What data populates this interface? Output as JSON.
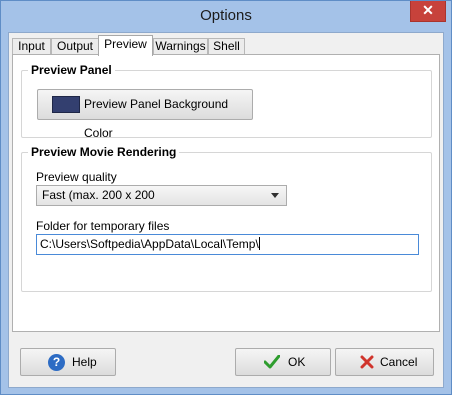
{
  "window": {
    "title": "Options",
    "close_glyph": "✕"
  },
  "tabs": [
    {
      "label": "Input"
    },
    {
      "label": "Output"
    },
    {
      "label": "Preview"
    },
    {
      "label": "Warnings"
    },
    {
      "label": "Shell"
    }
  ],
  "active_tab": "Preview",
  "preview_panel": {
    "legend": "Preview Panel",
    "bg_button_label": "Preview Panel Background Color",
    "bg_color": "#333f6f"
  },
  "movie_rendering": {
    "legend": "Preview Movie Rendering",
    "quality_label": "Preview quality",
    "quality_value": "Fast  (max. 200 x 200",
    "temp_label": "Folder for temporary files",
    "temp_value": "C:\\Users\\Softpedia\\AppData\\Local\\Temp\\"
  },
  "buttons": {
    "help": "Help",
    "ok": "OK",
    "cancel": "Cancel"
  },
  "icons": {
    "help": "help-question-icon",
    "ok": "green-checkmark-icon",
    "cancel": "red-x-icon",
    "dropdown": "chevron-down-icon"
  }
}
